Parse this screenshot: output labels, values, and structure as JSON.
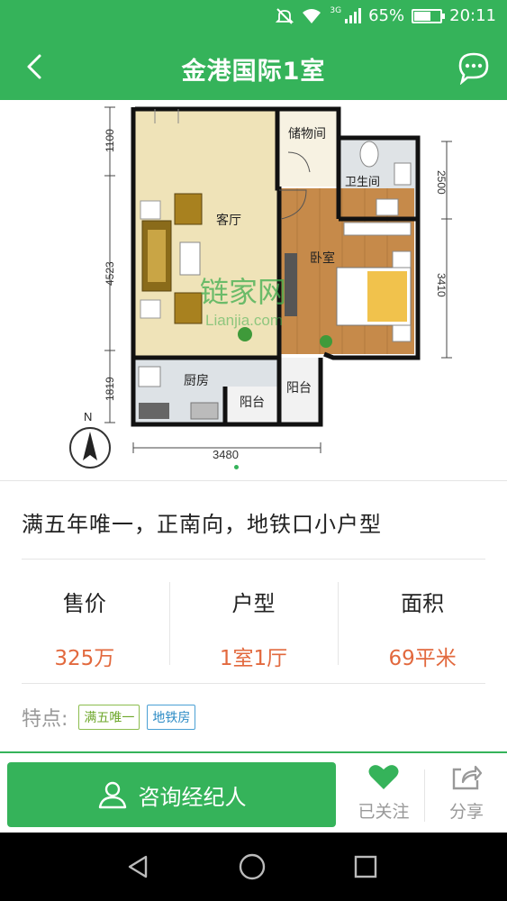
{
  "status_bar": {
    "net": "3G",
    "battery_text": "65%",
    "battery_level": 0.65,
    "time": "20:11"
  },
  "header": {
    "title": "金港国际1室",
    "back_icon": "chevron-left-icon",
    "message_icon": "chat-bubble-icon"
  },
  "floorplan": {
    "rooms": {
      "storage": "储物间",
      "bathroom": "卫生间",
      "living": "客厅",
      "bedroom": "卧室",
      "kitchen": "厨房",
      "balcony1": "阳台",
      "balcony2": "阳台"
    },
    "dims": {
      "d1100": "1100",
      "d4523": "4523",
      "d1819": "1819",
      "d2500": "2500",
      "d3410": "3410",
      "d3480": "3480"
    },
    "compass": "N",
    "watermark_cn": "链家网",
    "watermark_en": "Lianjia.com"
  },
  "listing": {
    "headline": "满五年唯一，正南向，地铁口小户型",
    "stats": [
      {
        "label": "售价",
        "value": "325万"
      },
      {
        "label": "户型",
        "value": "1室1厅"
      },
      {
        "label": "面积",
        "value": "69平米"
      }
    ],
    "features_label": "特点:",
    "tags": [
      "满五唯一",
      "地铁房"
    ]
  },
  "actions": {
    "consult": "咨询经纪人",
    "follow": "已关注",
    "share": "分享"
  },
  "colors": {
    "brand_green": "#35b35a",
    "value_orange": "#e2693e"
  }
}
